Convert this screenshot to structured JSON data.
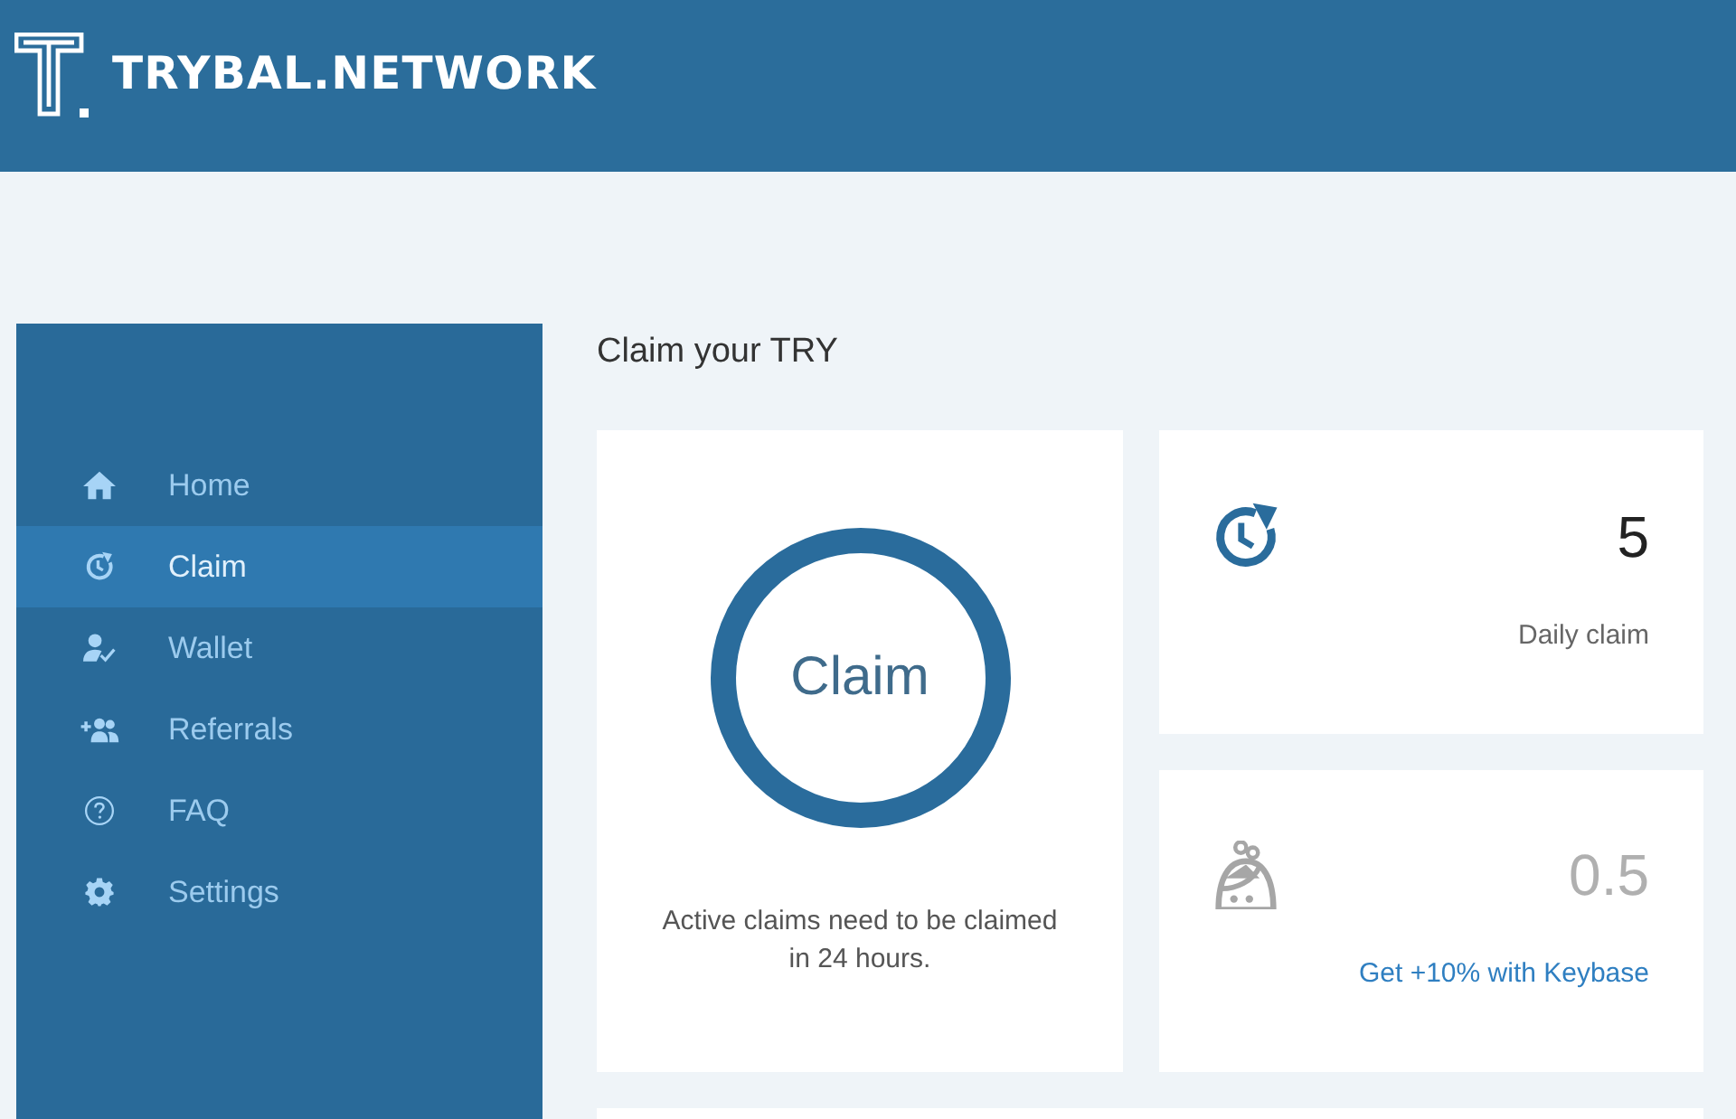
{
  "header": {
    "brand": "TRYBAL.NETWORK"
  },
  "sidebar": {
    "items": [
      {
        "kind": "home",
        "label": "Home",
        "selected": false
      },
      {
        "kind": "claim",
        "label": "Claim",
        "selected": true
      },
      {
        "kind": "wallet",
        "label": "Wallet",
        "selected": false
      },
      {
        "kind": "referrals",
        "label": "Referrals",
        "selected": false
      },
      {
        "kind": "faq",
        "label": "FAQ",
        "selected": false
      },
      {
        "kind": "settings",
        "label": "Settings",
        "selected": false
      }
    ]
  },
  "main": {
    "title": "Claim your TRY",
    "claim_card": {
      "button": "Claim",
      "note": "Active claims need to be claimed in 24 hours."
    },
    "stats": [
      {
        "kind": "daily",
        "value": "5",
        "label": "Daily claim"
      },
      {
        "kind": "bonus",
        "value": "0.5",
        "link": "Get +10% with Keybase"
      }
    ]
  }
}
